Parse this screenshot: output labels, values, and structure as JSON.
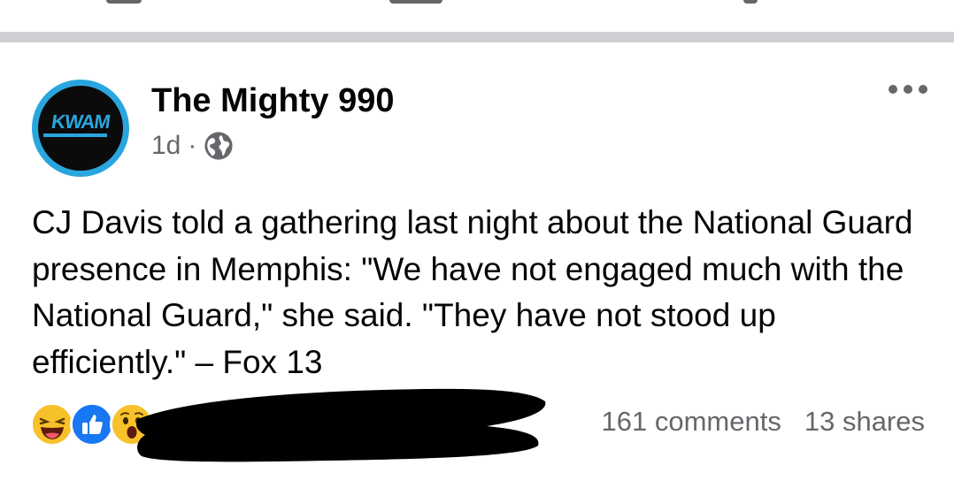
{
  "post": {
    "page_name": "The Mighty 990",
    "avatar_logo_text": "KWAM",
    "time_ago": "1d",
    "separator": "·",
    "privacy_icon": "globe-icon",
    "more_icon": "more-options-icon",
    "text": "CJ Davis told a gathering last night about the National Guard presence in Memphis: \"We have not engaged much with the National Guard,\" she said. \"They have not stood up efficiently.\" – Fox 13"
  },
  "footer": {
    "reaction_icons": [
      "haha-reaction-icon",
      "like-reaction-icon",
      "wow-reaction-icon"
    ],
    "comments": "161 comments",
    "shares": "13 shares"
  },
  "colors": {
    "divider": "#ced0d4",
    "secondary_text": "#65676b",
    "like_blue": "#1877f2",
    "emoji_yellow": "#f7c12b",
    "avatar_ring": "#2aa6df"
  }
}
